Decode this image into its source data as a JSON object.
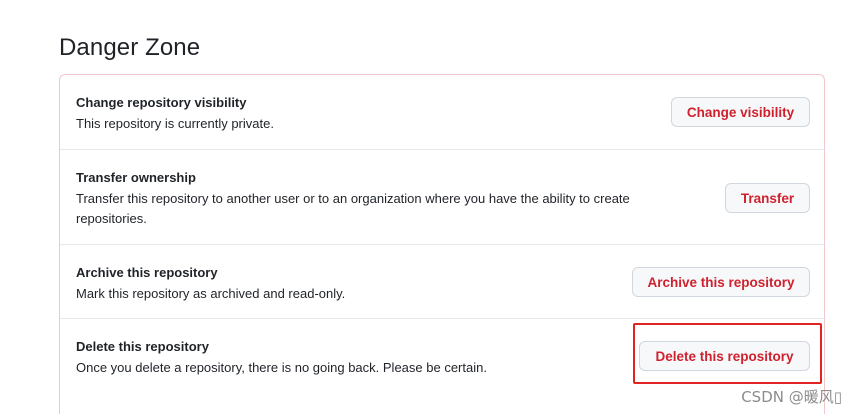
{
  "page_title": "Danger Zone",
  "rows": [
    {
      "title": "Change repository visibility",
      "description": "This repository is currently private.",
      "button": "Change visibility"
    },
    {
      "title": "Transfer ownership",
      "description_line1": "Transfer this repository to another user or to an organization where you have the ability to create",
      "description_line2": "repositories.",
      "button": "Transfer"
    },
    {
      "title": "Archive this repository",
      "description": "Mark this repository as archived and read-only.",
      "button": "Archive this repository"
    },
    {
      "title": "Delete this repository",
      "description": "Once you delete a repository, there is no going back. Please be certain.",
      "button": "Delete this repository"
    }
  ],
  "watermark": "CSDN @暖风▯",
  "colors": {
    "danger_text": "#cf222e",
    "danger_border": "#f0c8cc",
    "highlight_box": "#e02424"
  }
}
